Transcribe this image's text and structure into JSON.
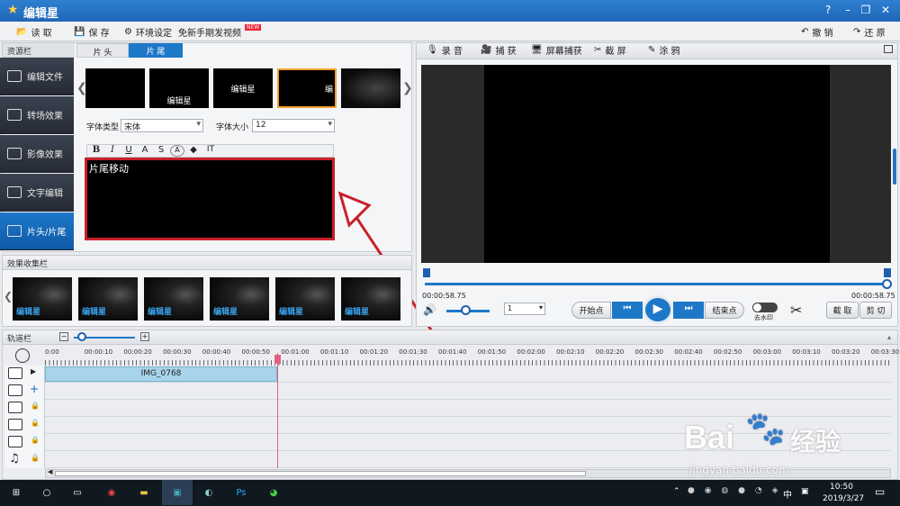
{
  "app": {
    "title": "编辑星",
    "colors": {
      "accent": "#1e78c8",
      "red_outline": "#c8202a"
    }
  },
  "menu": {
    "open": "读 取",
    "save": "保 存",
    "settings": "环境设定",
    "free_video": "免新手期发视频",
    "badge": "NEW",
    "undo": "撤 销",
    "redo": "还 原"
  },
  "window_controls": {
    "help": "?",
    "minimize": "–",
    "restore": "❐",
    "close": "✕"
  },
  "resource": {
    "header": "资源栏",
    "items": [
      "编辑文件",
      "转场效果",
      "影像效果",
      "文字编辑",
      "片头/片尾"
    ],
    "active": "片头/片尾"
  },
  "tabs": {
    "head": "片 头",
    "tail": "片 尾",
    "active": "片 尾"
  },
  "thumbs": [
    "",
    "编辑星",
    "编辑星",
    "编"
  ],
  "font": {
    "type_label": "字体类型",
    "type_value": "宋体",
    "size_label": "字体大小",
    "size_value": "12"
  },
  "format_buttons": [
    "B",
    "I",
    "U",
    "A",
    "S",
    "A",
    "◆",
    "IT"
  ],
  "text_content": "片尾移动",
  "effects": {
    "header": "效果收集栏",
    "items": [
      "编辑星",
      "编辑星",
      "编辑星",
      "编辑星",
      "编辑星",
      "编辑星"
    ]
  },
  "preview": {
    "tools": [
      "录 音",
      "捕 获",
      "屏幕捕获",
      "截 屏",
      "涂 鸦"
    ],
    "time_left": "00:00:58.75",
    "time_right": "00:00:58.75",
    "speed": "1",
    "start_btn": "开始点",
    "end_btn": "结束点",
    "watermark": "去水印",
    "cut": "截 取",
    "trim": "剪 切"
  },
  "timeline": {
    "header": "轨道栏",
    "ruler": [
      "0:00",
      "00:00:10",
      "00:00:20",
      "00:00:30",
      "00:00:40",
      "00:00:50",
      "00:01:00",
      "00:01:10",
      "00:01:20",
      "00:01:30",
      "00:01:40",
      "00:01:50",
      "00:02:00",
      "00:02:10",
      "00:02:20",
      "00:02:30",
      "00:02:40",
      "00:02:50",
      "00:03:00",
      "00:03:10",
      "00:03:20",
      "00:03:30"
    ],
    "clip": "IMG_0768"
  },
  "watermark_text": {
    "brand": "Bai",
    "brand2": "经验",
    "url": "jingyan.baidu.com"
  },
  "taskbar": {
    "time": "10:50",
    "date": "2019/3/27",
    "ime": "中"
  }
}
